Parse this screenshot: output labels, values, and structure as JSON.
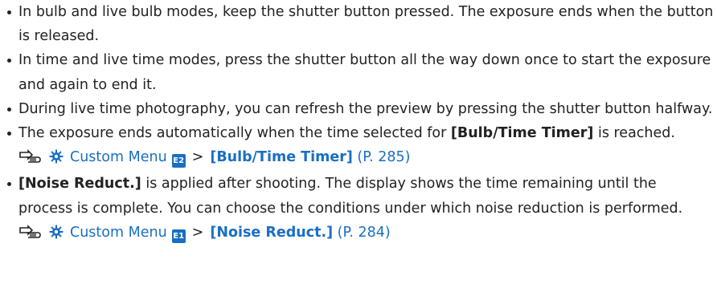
{
  "bullets": [
    {
      "text": "In bulb and live bulb modes, keep the shutter button pressed. The exposure ends when the button is released."
    },
    {
      "text": "In time and live time modes, press the shutter button all the way down once to start the exposure and again to end it."
    },
    {
      "text": "During live time photography, you can refresh the preview by pressing the shutter button halfway."
    },
    {
      "text_before": "The exposure ends automatically when the time selected for ",
      "bold": "[Bulb/Time Timer]",
      "text_after": " is reached.",
      "ref": {
        "icon": "reference-icon",
        "menu_icon": "gear-icon",
        "menu_label": "Custom Menu",
        "badge": "E2",
        "separator": ">",
        "item": "[Bulb/Time Timer]",
        "page": "(P. 285)"
      }
    },
    {
      "bold_start": "[Noise Reduct.]",
      "text": " is applied after shooting. The display shows the time remaining until the process is complete. You can choose the conditions under which noise reduction is performed.",
      "ref": {
        "icon": "reference-icon",
        "menu_icon": "gear-icon",
        "menu_label": "Custom Menu",
        "badge": "E1",
        "separator": ">",
        "item": "[Noise Reduct.]",
        "page": "(P. 284)"
      }
    }
  ],
  "colors": {
    "text": "#222222",
    "link": "#1a6fc2"
  }
}
